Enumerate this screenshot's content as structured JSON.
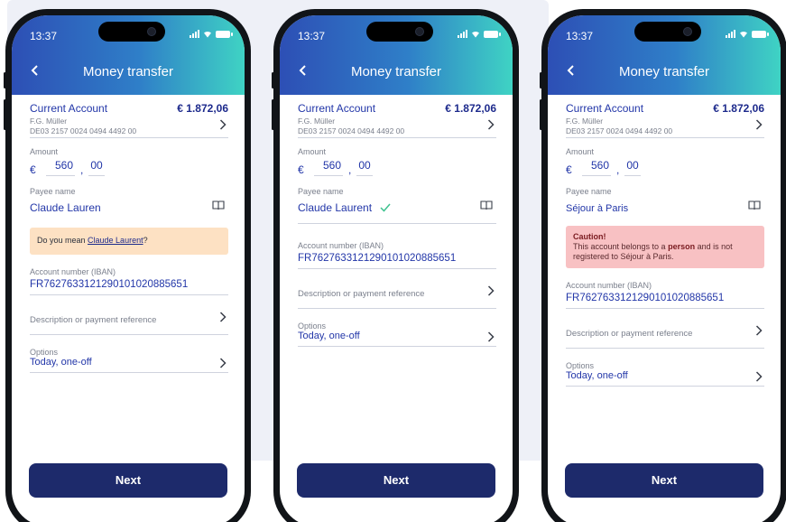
{
  "phones": [
    {
      "time": "13:37",
      "title": "Money transfer",
      "account": {
        "name": "Current Account",
        "balance": "€ 1.872,06",
        "holder": "F.G. Müller",
        "iban": "DE03 2157 0024 0494 4492 00"
      },
      "amount": {
        "label": "Amount",
        "currency": "€",
        "euros": "560",
        "sep": ",",
        "cents": "00"
      },
      "payee": {
        "label": "Payee name",
        "value": "Claude Lauren"
      },
      "hint": {
        "prefix": "Do you mean ",
        "link": "Claude Laurent",
        "suffix": "?"
      },
      "iban_field": {
        "label": "Account number (IBAN)",
        "value": "FR7627633121290101020885651"
      },
      "description": {
        "placeholder": "Description or payment reference"
      },
      "options": {
        "label": "Options",
        "value": "Today, one-off"
      },
      "next_label": "Next"
    },
    {
      "time": "13:37",
      "title": "Money transfer",
      "account": {
        "name": "Current Account",
        "balance": "€ 1.872,06",
        "holder": "F.G. Müller",
        "iban": "DE03 2157 0024 0494 4492 00"
      },
      "amount": {
        "label": "Amount",
        "currency": "€",
        "euros": "560",
        "sep": ",",
        "cents": "00"
      },
      "payee": {
        "label": "Payee name",
        "value": "Claude Laurent"
      },
      "iban_field": {
        "label": "Account number (IBAN)",
        "value": "FR7627633121290101020885651"
      },
      "description": {
        "placeholder": "Description or payment reference"
      },
      "options": {
        "label": "Options",
        "value": "Today, one-off"
      },
      "next_label": "Next"
    },
    {
      "time": "13:37",
      "title": "Money transfer",
      "account": {
        "name": "Current Account",
        "balance": "€ 1.872,06",
        "holder": "F.G. Müller",
        "iban": "DE03 2157 0024 0494 4492 00"
      },
      "amount": {
        "label": "Amount",
        "currency": "€",
        "euros": "560",
        "sep": ",",
        "cents": "00"
      },
      "payee": {
        "label": "Payee name",
        "value": "Séjour à Paris"
      },
      "caution": {
        "title": "Caution!",
        "line1_prefix": "This account belongs to a ",
        "line1_bold": "person",
        "line1_suffix": " and is not",
        "line2": "registered to Séjour à Paris."
      },
      "iban_field": {
        "label": "Account number (IBAN)",
        "value": "FR7627633121290101020885651"
      },
      "description": {
        "placeholder": "Description or payment reference"
      },
      "options": {
        "label": "Options",
        "value": "Today, one-off"
      },
      "next_label": "Next"
    }
  ],
  "colors": {
    "primary_blue": "#2236a8",
    "button_navy": "#1d2a6b",
    "hint_orange": "#fde1c3",
    "hint_red": "#f8c1c3",
    "check_green": "#3ec28f"
  }
}
